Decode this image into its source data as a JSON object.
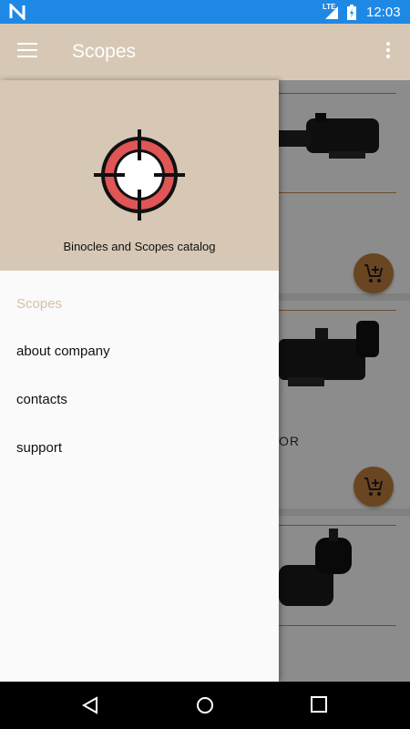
{
  "status_bar": {
    "network_label": "LTE",
    "time": "12:03"
  },
  "app_bar": {
    "title": "Scopes"
  },
  "drawer": {
    "subtitle": "Binocles and Scopes catalog",
    "items": [
      {
        "label": "Scopes",
        "active": true
      },
      {
        "label": "about company",
        "active": false
      },
      {
        "label": "contacts",
        "active": false
      },
      {
        "label": "support",
        "active": false
      }
    ]
  },
  "content": {
    "partial_product_name": "OR"
  },
  "colors": {
    "status_bar": "#1e88e5",
    "app_bar": "#d7c8b5",
    "drawer_header": "#d7c8b5",
    "accent": "#c27f3d",
    "logo_red": "#e05555",
    "divider": "#c98a55"
  },
  "icons": [
    "n-logo-icon",
    "signal-icon",
    "battery-icon",
    "menu-icon",
    "overflow-menu-icon",
    "crosshair-logo-icon",
    "add-to-cart-icon",
    "back-icon",
    "home-icon",
    "recents-icon"
  ]
}
